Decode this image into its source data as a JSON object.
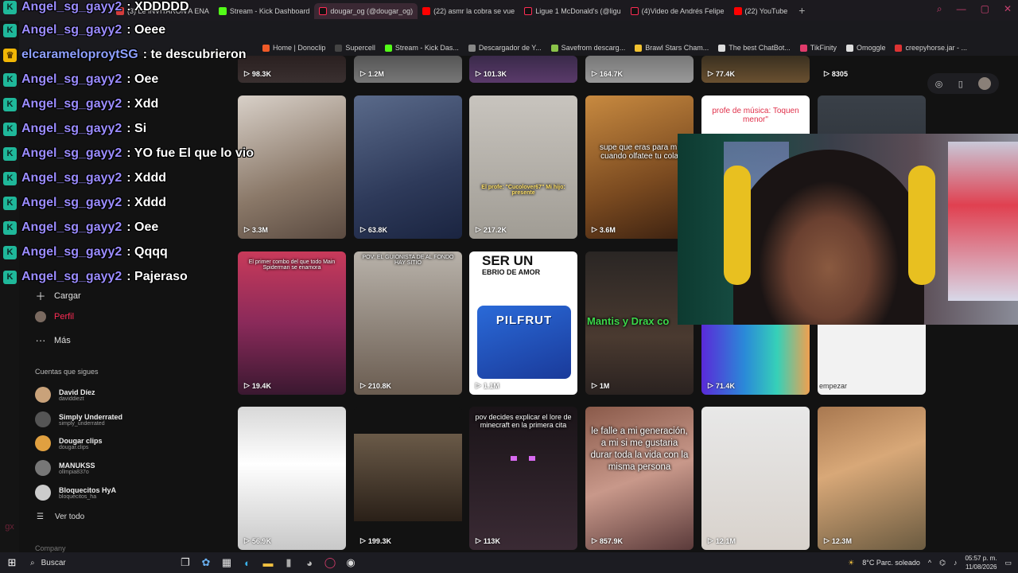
{
  "tabs": [
    {
      "label": "(3) Le INVITARON A ENA",
      "fav": "#d43c3c"
    },
    {
      "label": "Stream - Kick Dashboard",
      "fav": "#53fc18"
    },
    {
      "label": "dougar_og (@dougar_og)",
      "fav": "#111111",
      "active": true
    },
    {
      "label": "(22) asmr la cobra se vue",
      "fav": "#ff0000"
    },
    {
      "label": "Ligue 1 McDonald's (@ligu",
      "fav": "#111111"
    },
    {
      "label": "(4)Video de Andrés Felipe",
      "fav": "#111111"
    },
    {
      "label": "(22) YouTube",
      "fav": "#ff0000"
    }
  ],
  "bookmarks": [
    {
      "label": "Home | Donoclip",
      "fav": "#f05a28"
    },
    {
      "label": "Supercell",
      "fav": "#444"
    },
    {
      "label": "Stream - Kick Das...",
      "fav": "#53fc18"
    },
    {
      "label": "Descargador de Y...",
      "fav": "#888"
    },
    {
      "label": "Savefrom descarg...",
      "fav": "#8bc34a"
    },
    {
      "label": "Brawl Stars Cham...",
      "fav": "#f2c230"
    },
    {
      "label": "The best ChatBot...",
      "fav": "#ddd"
    },
    {
      "label": "TikFinity",
      "fav": "#e03b6b"
    },
    {
      "label": "Omoggle",
      "fav": "#ddd"
    },
    {
      "label": "creepyhorse.jar - ...",
      "fav": "#d33"
    }
  ],
  "chat": [
    {
      "user": "Angel_sg_gayy2",
      "msg": ": XDDDDD",
      "badge": "kick"
    },
    {
      "user": "Angel_sg_gayy2",
      "msg": ": Oeee",
      "badge": "kick"
    },
    {
      "user": "elcarameloproytSG",
      "msg": ": te descubrieron",
      "badge": "crown"
    },
    {
      "user": "Angel_sg_gayy2",
      "msg": ": Oee",
      "badge": "kick"
    },
    {
      "user": "Angel_sg_gayy2",
      "msg": ": Xdd",
      "badge": "kick"
    },
    {
      "user": "Angel_sg_gayy2",
      "msg": ": Si",
      "badge": "kick"
    },
    {
      "user": "Angel_sg_gayy2",
      "msg": ": YO fue El que lo vio",
      "badge": "kick"
    },
    {
      "user": "Angel_sg_gayy2",
      "msg": ": Xddd",
      "badge": "kick"
    },
    {
      "user": "Angel_sg_gayy2",
      "msg": ": Xddd",
      "badge": "kick"
    },
    {
      "user": "Angel_sg_gayy2",
      "msg": ": Oee",
      "badge": "kick"
    },
    {
      "user": "Angel_sg_gayy2",
      "msg": ": Qqqq",
      "badge": "kick"
    },
    {
      "user": "Angel_sg_gayy2",
      "msg": ": Pajeraso",
      "badge": "kick"
    }
  ],
  "sidebar": {
    "cargar": "Cargar",
    "perfil": "Perfil",
    "mas": "Más",
    "follow_title": "Cuentas que sigues",
    "following": [
      {
        "name": "David Díez",
        "handle": "daviddiezt",
        "color": "#c9a27a"
      },
      {
        "name": "Simply Underrated",
        "handle": "simply_underrated",
        "color": "#555"
      },
      {
        "name": "Dougar clips",
        "handle": "dougar.clips",
        "color": "#e0a040"
      },
      {
        "name": "MANUKSS",
        "handle": "ollmpia837o",
        "color": "#777"
      },
      {
        "name": "Bloquecitos HyA",
        "handle": "bloquecitos_ha",
        "color": "#ccc"
      }
    ],
    "see_all": "Ver todo",
    "company": "Company"
  },
  "grid": {
    "top_row": [
      "98.3K",
      "1.2M",
      "101.3K",
      "164.7K",
      "77.4K",
      "8305"
    ],
    "row1": [
      {
        "views": "3.3M",
        "caption": ""
      },
      {
        "views": "63.8K",
        "caption": ""
      },
      {
        "views": "217.2K",
        "caption": "El profe: \"Cucolover67\" Mi hijo: presente"
      },
      {
        "views": "3.6M",
        "caption": "supe que eras para mí cuando olfatee tu cola"
      },
      {
        "views": "",
        "caption": "profe de música: Toquen menor\""
      },
      {
        "views": "",
        "caption": ""
      }
    ],
    "row2": [
      {
        "views": "19.4K",
        "caption": "El primer combo del que todo Main Spiderman se enamora"
      },
      {
        "views": "210.8K",
        "caption": "POV: EL GUIONISTA DE AL FONDO HAY SITIO"
      },
      {
        "views": "1.1M",
        "caption_big": "SER UN",
        "caption_small": "EBRIO DE AMOR",
        "bag": "PILFRUT"
      },
      {
        "views": "1M",
        "caption": "Mantis y Drax co"
      },
      {
        "views": "71.4K",
        "caption": ""
      },
      {
        "views": "",
        "caption": "empezar"
      }
    ],
    "row3": [
      {
        "views": "56.9K",
        "caption": ""
      },
      {
        "views": "199.3K",
        "caption": ""
      },
      {
        "views": "113K",
        "caption": "pov decides explicar el lore de minecraft en la primera cita"
      },
      {
        "views": "857.9K",
        "caption": "le falle a mi generación, a mi si me gustaria durar toda la vida con la misma persona"
      },
      {
        "views": "12.1M",
        "caption": ""
      },
      {
        "views": "12.3M",
        "caption": ""
      }
    ]
  },
  "taskbar": {
    "search": "Buscar",
    "weather": "8°C  Parc. soleado",
    "time": "05:57 p. m.",
    "date": "11/08/2026"
  },
  "colors": {
    "accent": "#fe2c55",
    "kick": "#1fb89a",
    "gx": "#d33c6a"
  }
}
